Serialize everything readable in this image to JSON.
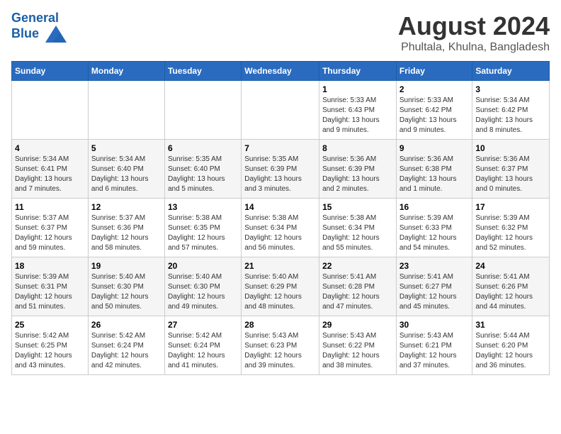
{
  "header": {
    "logo_line1": "General",
    "logo_line2": "Blue",
    "title": "August 2024",
    "subtitle": "Phultala, Khulna, Bangladesh"
  },
  "weekdays": [
    "Sunday",
    "Monday",
    "Tuesday",
    "Wednesday",
    "Thursday",
    "Friday",
    "Saturday"
  ],
  "weeks": [
    [
      {
        "num": "",
        "info": ""
      },
      {
        "num": "",
        "info": ""
      },
      {
        "num": "",
        "info": ""
      },
      {
        "num": "",
        "info": ""
      },
      {
        "num": "1",
        "info": "Sunrise: 5:33 AM\nSunset: 6:43 PM\nDaylight: 13 hours\nand 9 minutes."
      },
      {
        "num": "2",
        "info": "Sunrise: 5:33 AM\nSunset: 6:42 PM\nDaylight: 13 hours\nand 9 minutes."
      },
      {
        "num": "3",
        "info": "Sunrise: 5:34 AM\nSunset: 6:42 PM\nDaylight: 13 hours\nand 8 minutes."
      }
    ],
    [
      {
        "num": "4",
        "info": "Sunrise: 5:34 AM\nSunset: 6:41 PM\nDaylight: 13 hours\nand 7 minutes."
      },
      {
        "num": "5",
        "info": "Sunrise: 5:34 AM\nSunset: 6:40 PM\nDaylight: 13 hours\nand 6 minutes."
      },
      {
        "num": "6",
        "info": "Sunrise: 5:35 AM\nSunset: 6:40 PM\nDaylight: 13 hours\nand 5 minutes."
      },
      {
        "num": "7",
        "info": "Sunrise: 5:35 AM\nSunset: 6:39 PM\nDaylight: 13 hours\nand 3 minutes."
      },
      {
        "num": "8",
        "info": "Sunrise: 5:36 AM\nSunset: 6:39 PM\nDaylight: 13 hours\nand 2 minutes."
      },
      {
        "num": "9",
        "info": "Sunrise: 5:36 AM\nSunset: 6:38 PM\nDaylight: 13 hours\nand 1 minute."
      },
      {
        "num": "10",
        "info": "Sunrise: 5:36 AM\nSunset: 6:37 PM\nDaylight: 13 hours\nand 0 minutes."
      }
    ],
    [
      {
        "num": "11",
        "info": "Sunrise: 5:37 AM\nSunset: 6:37 PM\nDaylight: 12 hours\nand 59 minutes."
      },
      {
        "num": "12",
        "info": "Sunrise: 5:37 AM\nSunset: 6:36 PM\nDaylight: 12 hours\nand 58 minutes."
      },
      {
        "num": "13",
        "info": "Sunrise: 5:38 AM\nSunset: 6:35 PM\nDaylight: 12 hours\nand 57 minutes."
      },
      {
        "num": "14",
        "info": "Sunrise: 5:38 AM\nSunset: 6:34 PM\nDaylight: 12 hours\nand 56 minutes."
      },
      {
        "num": "15",
        "info": "Sunrise: 5:38 AM\nSunset: 6:34 PM\nDaylight: 12 hours\nand 55 minutes."
      },
      {
        "num": "16",
        "info": "Sunrise: 5:39 AM\nSunset: 6:33 PM\nDaylight: 12 hours\nand 54 minutes."
      },
      {
        "num": "17",
        "info": "Sunrise: 5:39 AM\nSunset: 6:32 PM\nDaylight: 12 hours\nand 52 minutes."
      }
    ],
    [
      {
        "num": "18",
        "info": "Sunrise: 5:39 AM\nSunset: 6:31 PM\nDaylight: 12 hours\nand 51 minutes."
      },
      {
        "num": "19",
        "info": "Sunrise: 5:40 AM\nSunset: 6:30 PM\nDaylight: 12 hours\nand 50 minutes."
      },
      {
        "num": "20",
        "info": "Sunrise: 5:40 AM\nSunset: 6:30 PM\nDaylight: 12 hours\nand 49 minutes."
      },
      {
        "num": "21",
        "info": "Sunrise: 5:40 AM\nSunset: 6:29 PM\nDaylight: 12 hours\nand 48 minutes."
      },
      {
        "num": "22",
        "info": "Sunrise: 5:41 AM\nSunset: 6:28 PM\nDaylight: 12 hours\nand 47 minutes."
      },
      {
        "num": "23",
        "info": "Sunrise: 5:41 AM\nSunset: 6:27 PM\nDaylight: 12 hours\nand 45 minutes."
      },
      {
        "num": "24",
        "info": "Sunrise: 5:41 AM\nSunset: 6:26 PM\nDaylight: 12 hours\nand 44 minutes."
      }
    ],
    [
      {
        "num": "25",
        "info": "Sunrise: 5:42 AM\nSunset: 6:25 PM\nDaylight: 12 hours\nand 43 minutes."
      },
      {
        "num": "26",
        "info": "Sunrise: 5:42 AM\nSunset: 6:24 PM\nDaylight: 12 hours\nand 42 minutes."
      },
      {
        "num": "27",
        "info": "Sunrise: 5:42 AM\nSunset: 6:24 PM\nDaylight: 12 hours\nand 41 minutes."
      },
      {
        "num": "28",
        "info": "Sunrise: 5:43 AM\nSunset: 6:23 PM\nDaylight: 12 hours\nand 39 minutes."
      },
      {
        "num": "29",
        "info": "Sunrise: 5:43 AM\nSunset: 6:22 PM\nDaylight: 12 hours\nand 38 minutes."
      },
      {
        "num": "30",
        "info": "Sunrise: 5:43 AM\nSunset: 6:21 PM\nDaylight: 12 hours\nand 37 minutes."
      },
      {
        "num": "31",
        "info": "Sunrise: 5:44 AM\nSunset: 6:20 PM\nDaylight: 12 hours\nand 36 minutes."
      }
    ]
  ]
}
